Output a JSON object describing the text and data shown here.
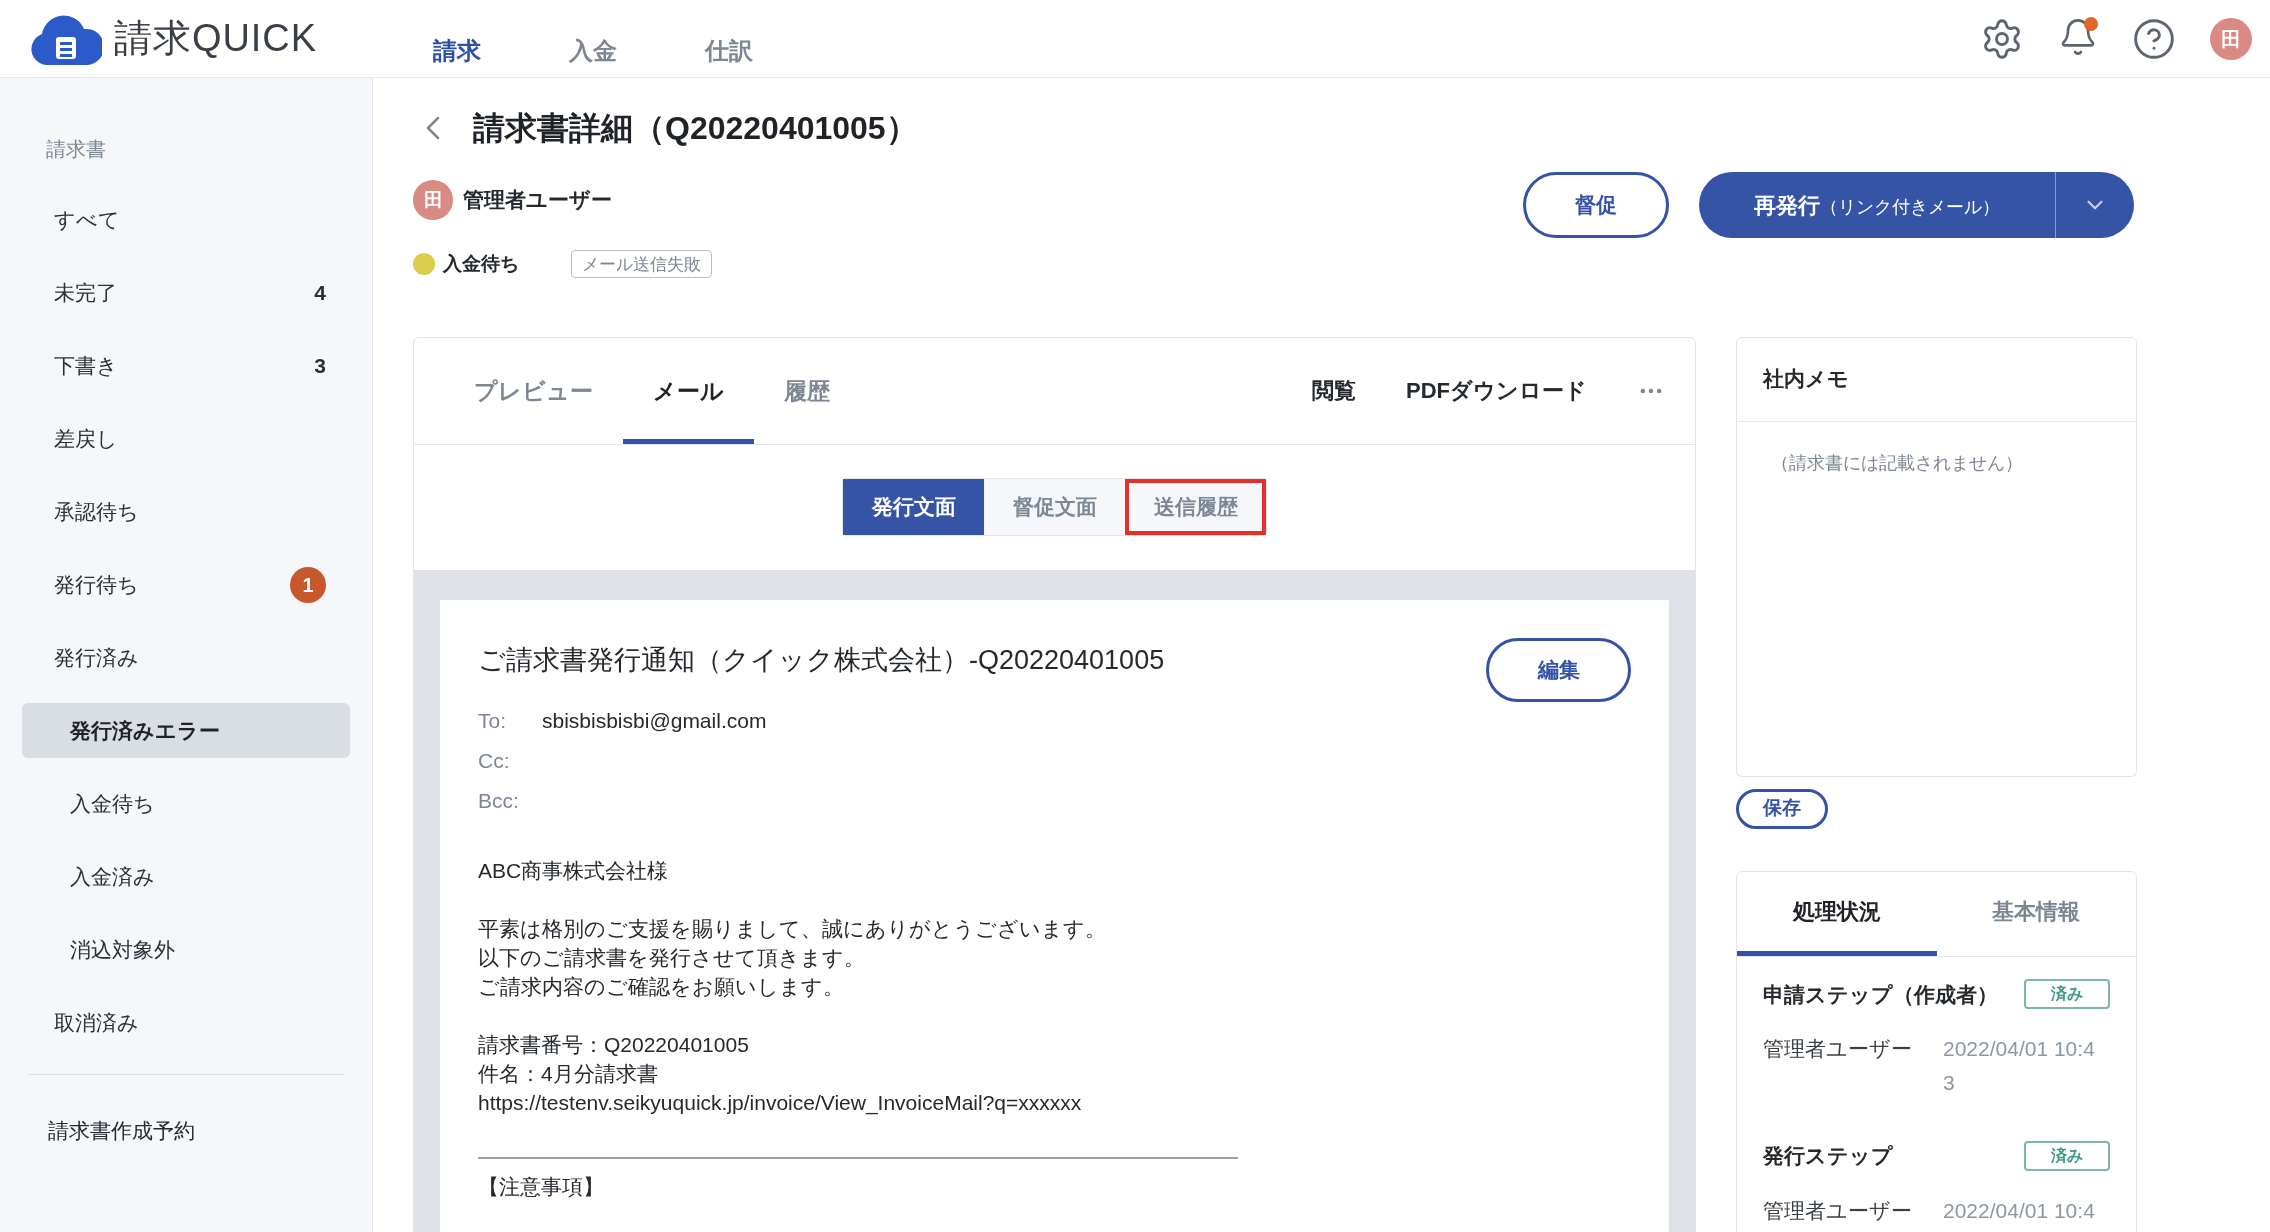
{
  "app": {
    "logo_text": "請求QUICK",
    "nav": [
      {
        "label": "請求",
        "selected": true
      },
      {
        "label": "入金",
        "selected": false
      },
      {
        "label": "仕訳",
        "selected": false
      }
    ],
    "notifications": true,
    "avatar": "田"
  },
  "sidebar": {
    "section": "請求書",
    "items": [
      {
        "label": "すべて",
        "selected": false
      },
      {
        "label": "未完了",
        "count": "4",
        "selected": false
      },
      {
        "label": "下書き",
        "count": "3",
        "selected": false
      },
      {
        "label": "差戻し",
        "selected": false
      },
      {
        "label": "承認待ち",
        "selected": false
      },
      {
        "label": "発行待ち",
        "badge": "1",
        "selected": false
      },
      {
        "label": "発行済み",
        "selected": false,
        "children": [
          {
            "label": "発行済みエラー",
            "selected": true
          },
          {
            "label": "入金待ち",
            "selected": false
          },
          {
            "label": "入金済み",
            "selected": false
          },
          {
            "label": "消込対象外",
            "selected": false
          }
        ]
      },
      {
        "label": "取消済み",
        "selected": false
      }
    ],
    "footer_item": "請求書作成予約"
  },
  "page": {
    "title": "請求書詳細（Q20220401005）",
    "owner_avatar": "田",
    "owner": "管理者ユーザー",
    "status": {
      "label": "入金待ち",
      "color": "#d9cf4a"
    },
    "tag": "メール送信失敗",
    "buttons": {
      "remind": "督促",
      "reissue": "再発行",
      "reissue_note": "（リンク付きメール）"
    }
  },
  "card": {
    "tabs": [
      {
        "label": "プレビュー",
        "selected": false
      },
      {
        "label": "メール",
        "selected": true
      },
      {
        "label": "履歴",
        "selected": false
      }
    ],
    "actions": [
      "閲覧",
      "PDFダウンロード"
    ],
    "segments": [
      {
        "label": "発行文面",
        "selected": true,
        "highlighted": false
      },
      {
        "label": "督促文面",
        "selected": false,
        "highlighted": false
      },
      {
        "label": "送信履歴",
        "selected": false,
        "highlighted": true
      }
    ],
    "email": {
      "subject": "ご請求書発行通知（クイック株式会社）-Q20220401005",
      "edit": "編集",
      "headers": [
        {
          "label": "To:",
          "value": "sbisbisbisbi@gmail.com"
        },
        {
          "label": "Cc:"
        },
        {
          "label": "Bcc:"
        }
      ],
      "paragraphs": [
        [
          "ABC商事株式会社様"
        ],
        [
          "平素は格別のご支援を賜りまして、誠にありがとうございます。",
          "以下のご請求書を発行させて頂きます。",
          "ご請求内容のご確認をお願いします。"
        ],
        [
          "請求書番号：Q20220401005",
          "件名：4月分請求書",
          "https://testenv.seikyuquick.jp/invoice/View_InvoiceMail?q=xxxxxx"
        ]
      ],
      "notice": "【注意事項】"
    }
  },
  "memo": {
    "title": "社内メモ",
    "placeholder": "（請求書には記載されません）",
    "save": "保存"
  },
  "process": {
    "tabs": [
      {
        "label": "処理状況",
        "selected": true
      },
      {
        "label": "基本情報",
        "selected": false
      }
    ],
    "steps": [
      {
        "title": "申請ステップ（作成者）",
        "status": "済み",
        "user": "管理者ユーザー",
        "time": "2022/04/01 10:43"
      },
      {
        "title": "発行ステップ",
        "status": "済み",
        "user": "管理者ユーザー",
        "time": "2022/04/01 10:4"
      }
    ]
  }
}
